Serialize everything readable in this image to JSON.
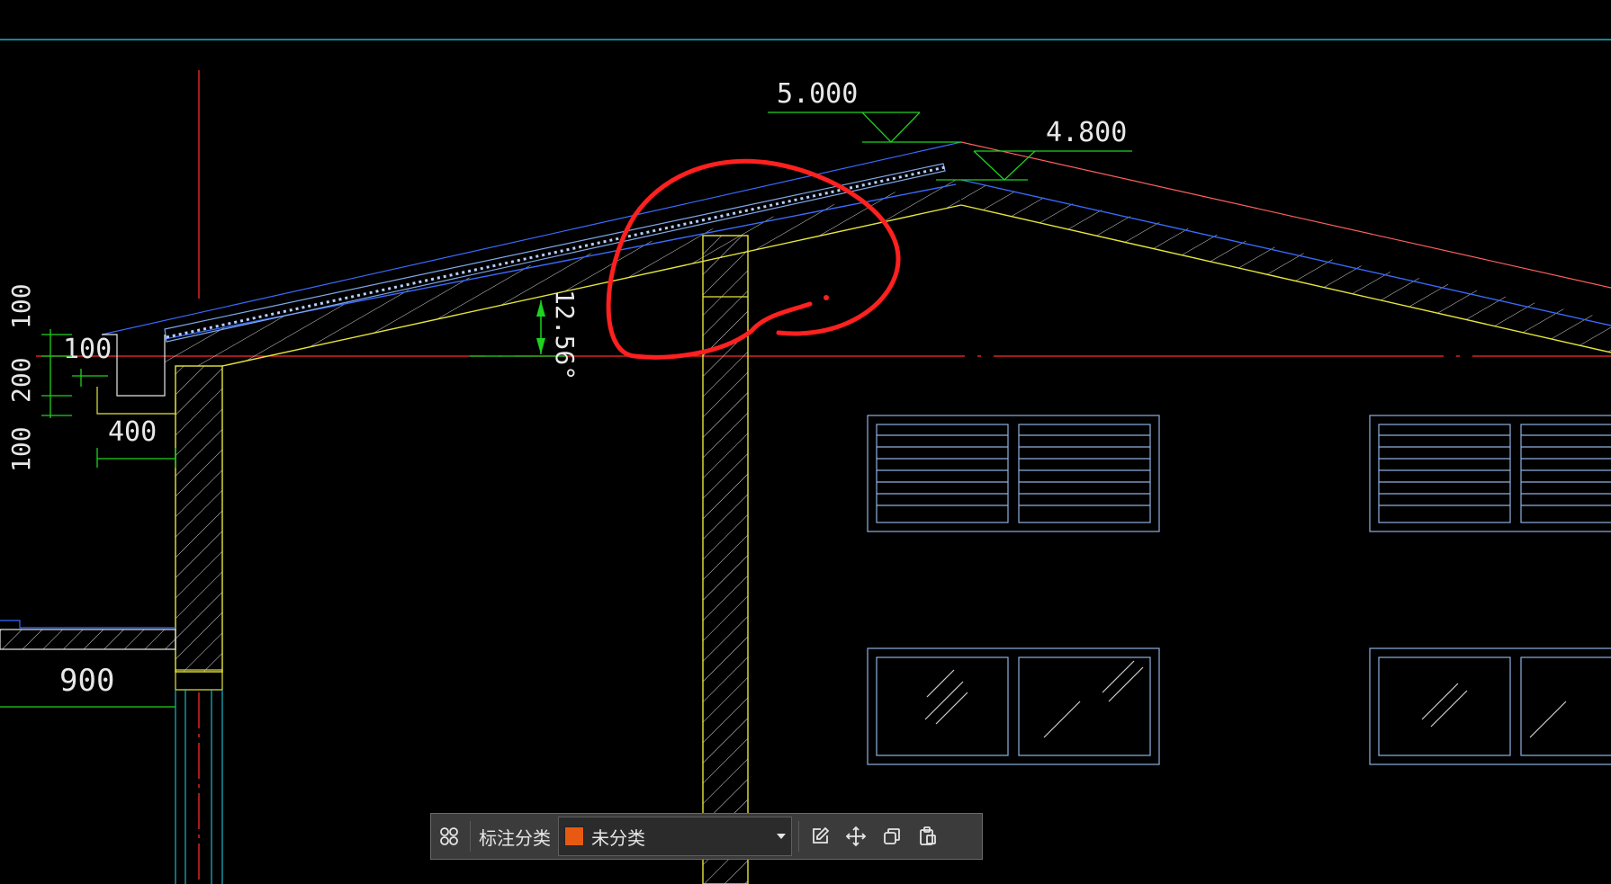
{
  "colors": {
    "background": "#000000",
    "cyan": "#19b6c8",
    "red": "#ff2a2a",
    "yellow": "#e6e63c",
    "green": "#1fd21f",
    "blue": "#3a6bff",
    "window": "#8fb0e0",
    "white": "#e8e8e8",
    "annotation": "#ff2020",
    "category_swatch": "#e85a12"
  },
  "drawing": {
    "elevations": [
      "5.000",
      "4.800"
    ],
    "angle_label": "12.56°",
    "eave_dims": [
      "100",
      "200",
      "100",
      "100",
      "400"
    ],
    "bottom_dim": "900"
  },
  "toolbar": {
    "grid_icon": "grid-icon",
    "label": "标注分类",
    "category": {
      "value": "未分类",
      "swatch_color": "#e85a12"
    },
    "actions": [
      "edit-icon",
      "move-icon",
      "copy-icon",
      "paste-icon"
    ]
  }
}
